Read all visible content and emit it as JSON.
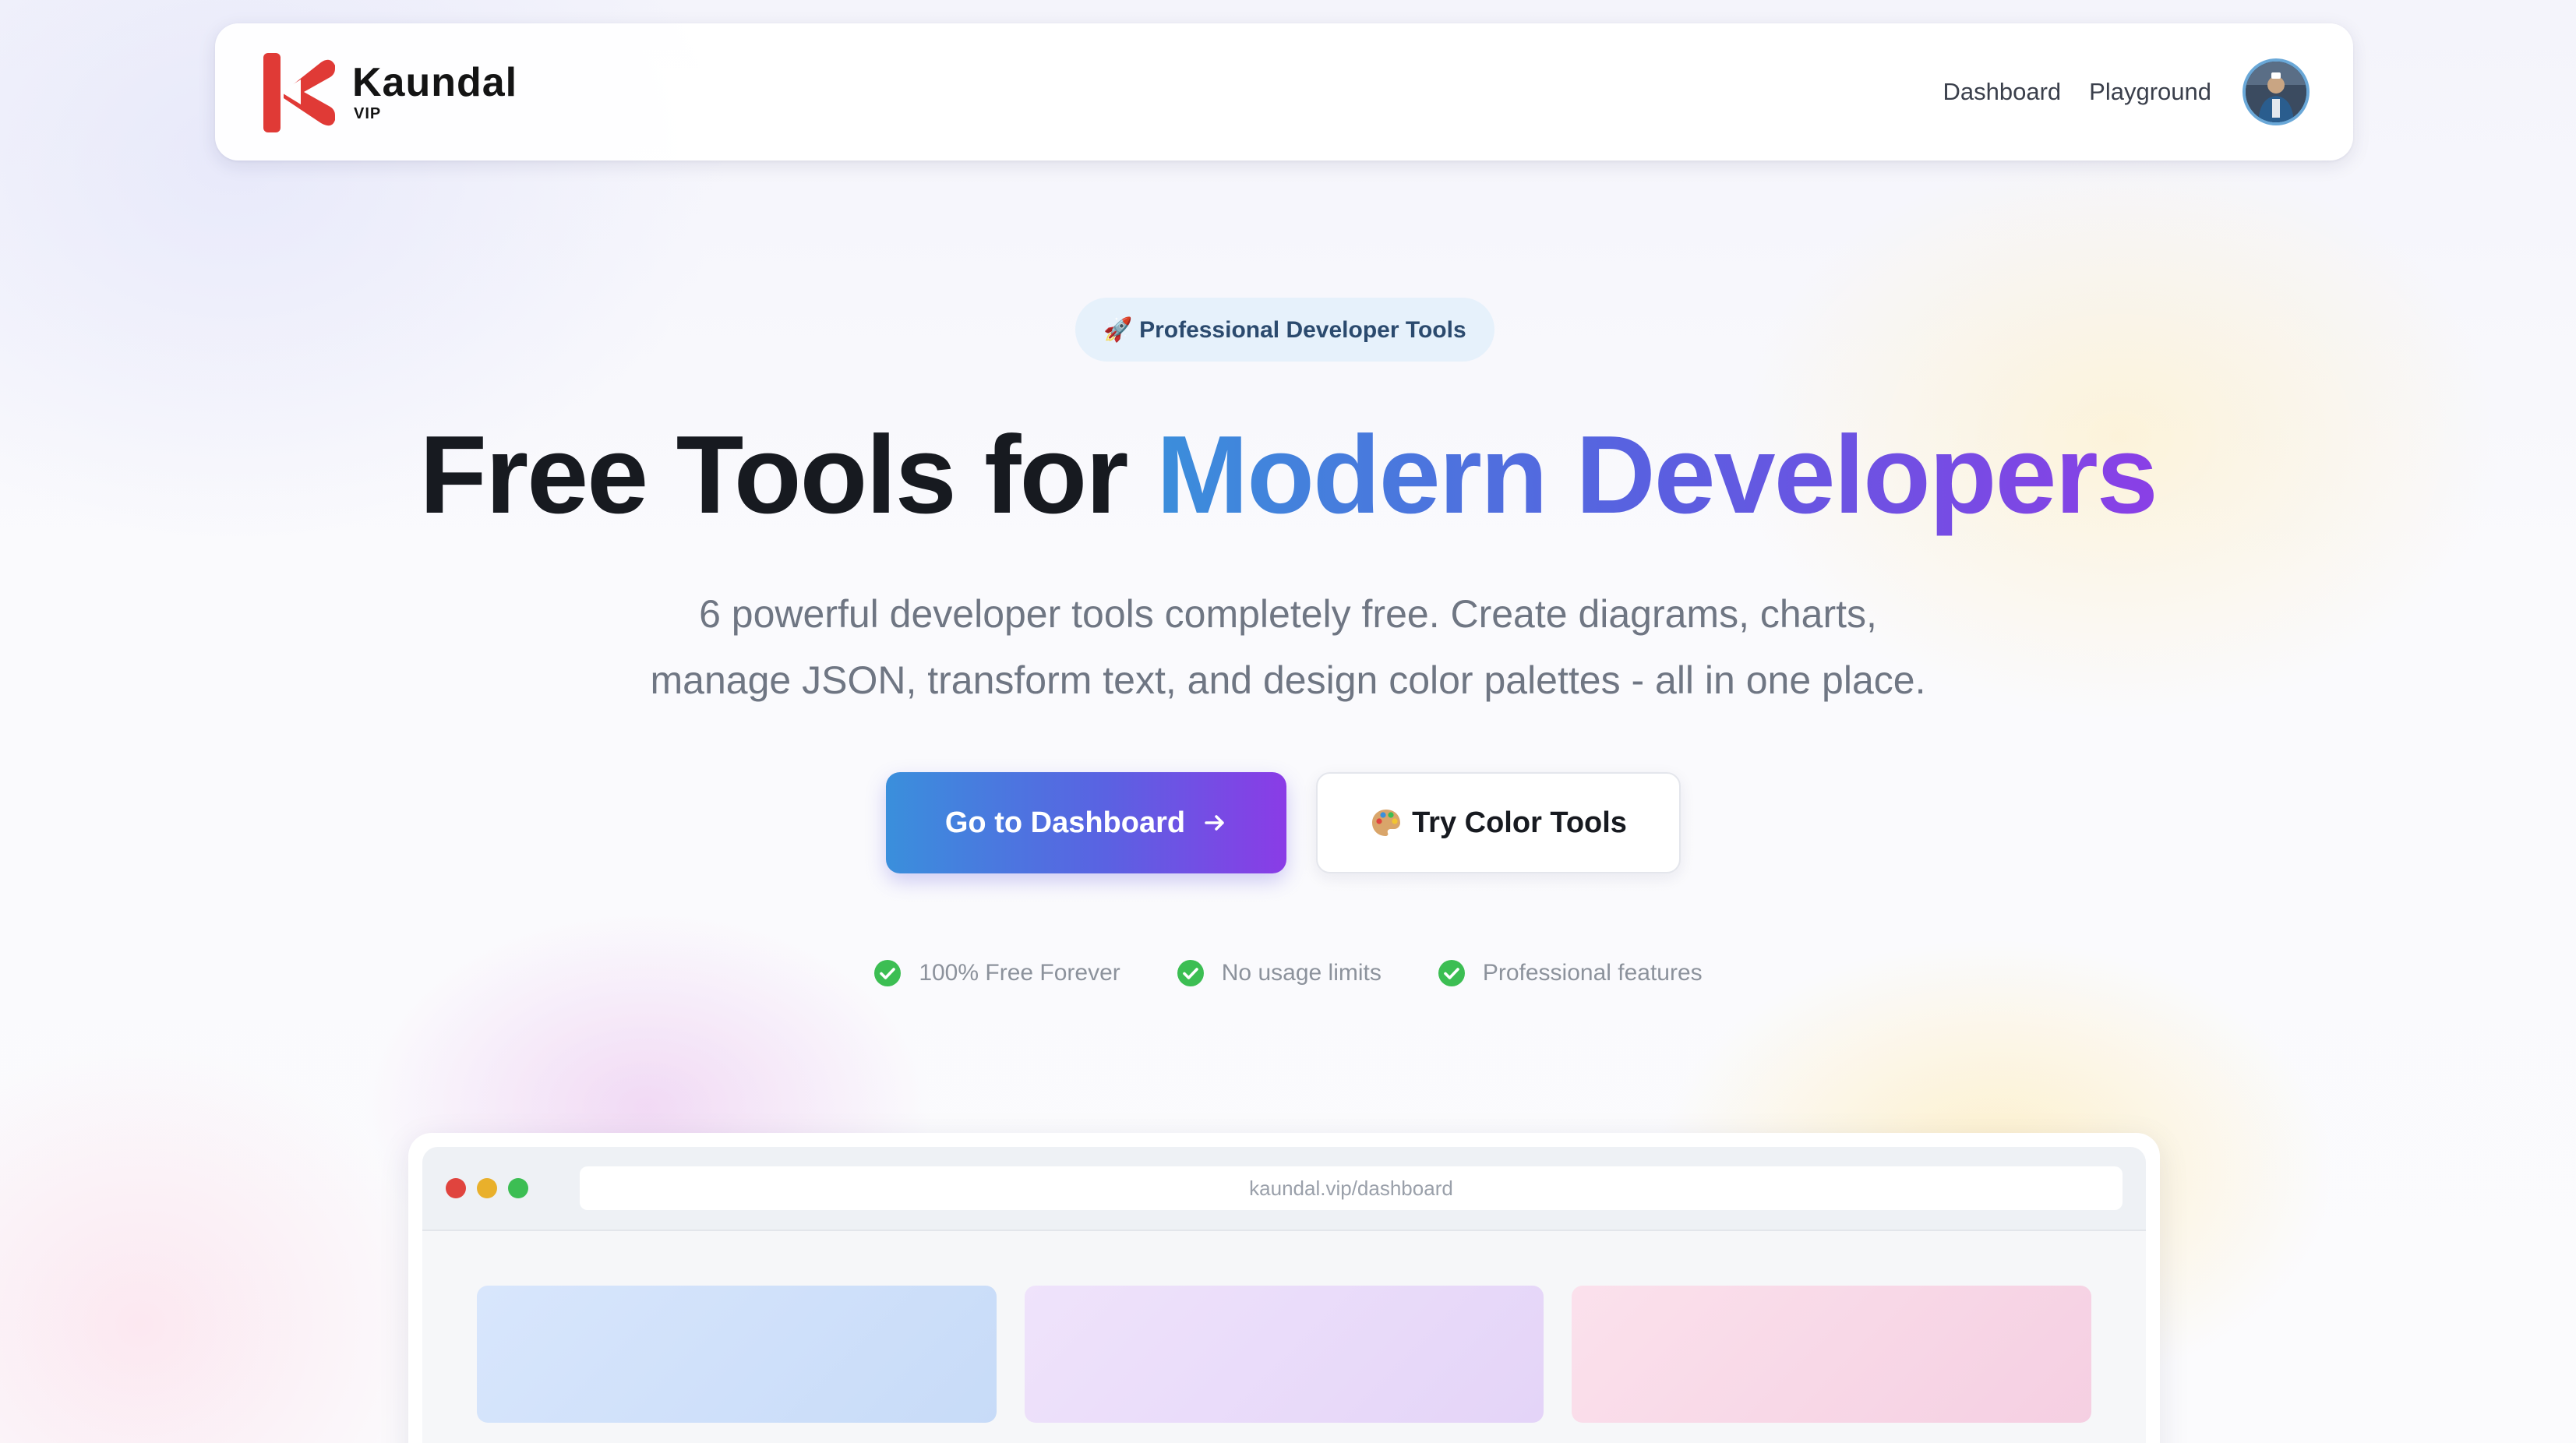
{
  "navbar": {
    "brand_name": "Kaundal",
    "brand_sub": "VIP",
    "links": [
      {
        "label": "Dashboard"
      },
      {
        "label": "Playground"
      }
    ]
  },
  "hero": {
    "badge": "🚀 Professional Developer Tools",
    "title_plain": "Free Tools for ",
    "title_highlight": "Modern Developers",
    "subtitle_line1": "6 powerful developer tools completely free. Create diagrams, charts,",
    "subtitle_line2": "manage JSON, transform text, and design color palettes - all in one place.",
    "primary_button": "Go to Dashboard",
    "secondary_button": "Try Color Tools",
    "features": [
      {
        "label": "100% Free Forever"
      },
      {
        "label": "No usage limits"
      },
      {
        "label": "Professional features"
      }
    ]
  },
  "mockup": {
    "url": "kaundal.vip/dashboard",
    "window_dots": [
      "#e0443e",
      "#e9b02b",
      "#3cbe53"
    ],
    "cards": [
      "#cfe0fb",
      "#e9ddfa",
      "#f8d9e8"
    ]
  },
  "colors": {
    "accent_start": "#3b8edb",
    "accent_end": "#8a3fe6",
    "logo_red": "#e03a36",
    "check_green": "#3cbe53"
  },
  "icons": {
    "badge": "rocket-icon",
    "primary": "arrow-right-icon",
    "secondary": "palette-icon",
    "feature": "check-circle-icon"
  }
}
